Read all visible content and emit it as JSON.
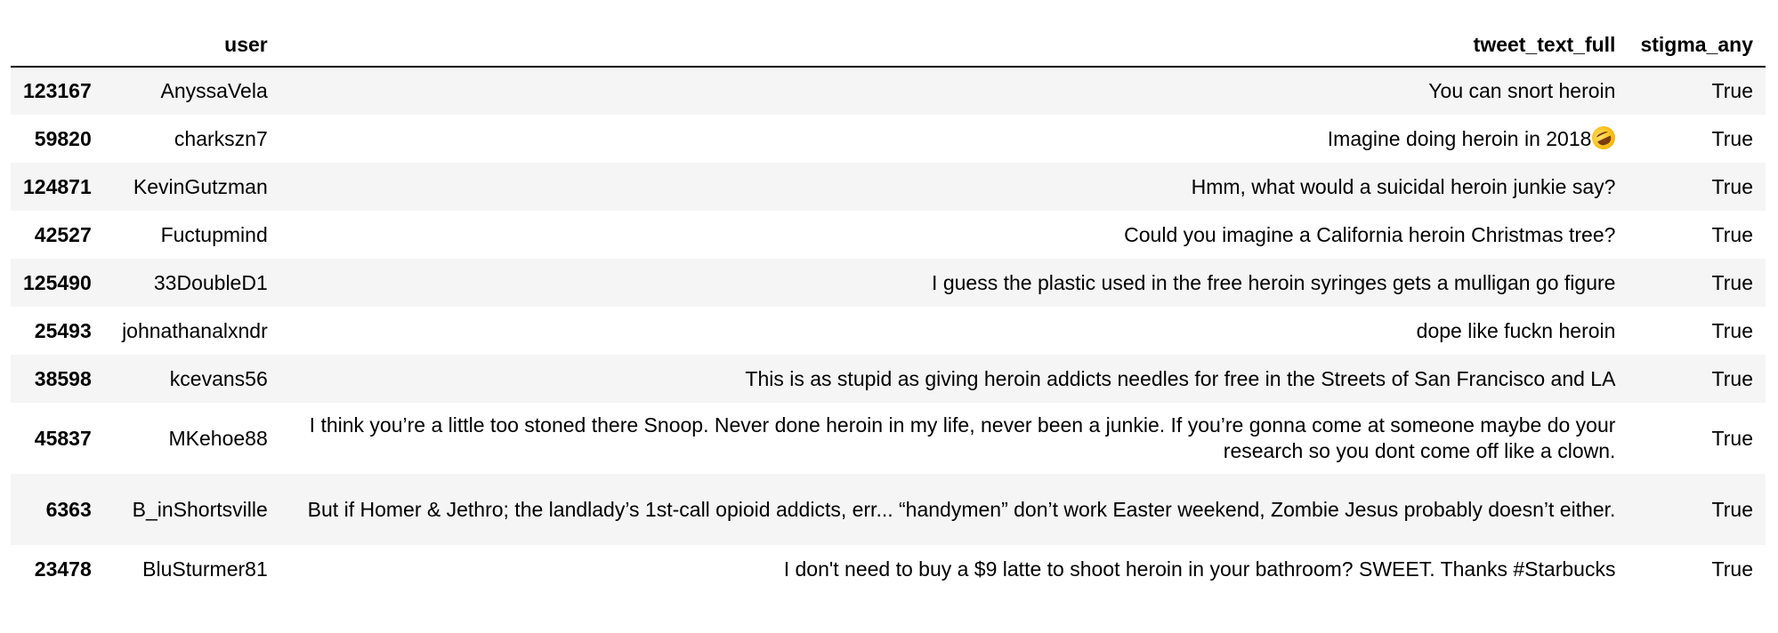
{
  "table": {
    "columns": [
      "",
      "user",
      "tweet_text_full",
      "stigma_any"
    ],
    "rows": [
      {
        "index": "123167",
        "user": "AnyssaVela",
        "tweet": "You can snort heroin",
        "stigma": "True"
      },
      {
        "index": "59820",
        "user": "charkszn7",
        "tweet": "Imagine doing heroin in 2018",
        "emoji": "rolling-on-floor-laughing-emoji",
        "stigma": "True"
      },
      {
        "index": "124871",
        "user": "KevinGutzman",
        "tweet": "Hmm, what would a suicidal heroin junkie say?",
        "stigma": "True"
      },
      {
        "index": "42527",
        "user": "Fuctupmind",
        "tweet": "Could you imagine a California heroin Christmas tree?",
        "stigma": "True"
      },
      {
        "index": "125490",
        "user": "33DoubleD1",
        "tweet": "I guess the plastic used in the free heroin syringes gets a mulligan go figure",
        "stigma": "True"
      },
      {
        "index": "25493",
        "user": "johnathanalxndr",
        "tweet": "dope like fuckn heroin",
        "stigma": "True"
      },
      {
        "index": "38598",
        "user": "kcevans56",
        "tweet": "This is as stupid as giving heroin addicts needles for free in the Streets of San Francisco and LA",
        "stigma": "True"
      },
      {
        "index": "45837",
        "user": "MKehoe88",
        "tweet": "I think you’re a little too stoned there Snoop. Never done heroin in my life, never been a junkie. If you’re gonna come at someone maybe do your research so you dont come off like a clown.",
        "stigma": "True"
      },
      {
        "index": "6363",
        "user": "B_inShortsville",
        "tweet": "But if Homer & Jethro; the landlady’s 1st-call opioid addicts, err... “handymen” don’t work Easter weekend, Zombie Jesus probably doesn’t either.",
        "stigma": "True"
      },
      {
        "index": "23478",
        "user": "BluSturmer81",
        "tweet": "I don't need to buy a $9 latte to shoot heroin in your bathroom? SWEET. Thanks #Starbucks",
        "stigma": "True"
      }
    ]
  }
}
